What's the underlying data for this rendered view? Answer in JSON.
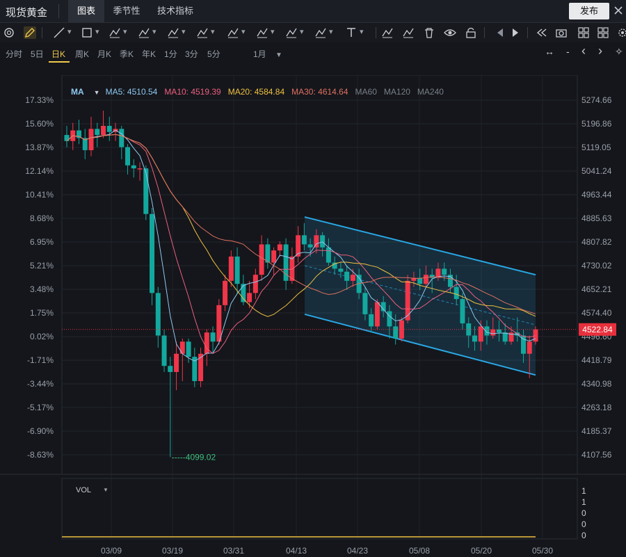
{
  "app": {
    "title": "现货黄金"
  },
  "tabs": [
    {
      "label": "图表",
      "active": true
    },
    {
      "label": "季节性",
      "active": false
    },
    {
      "label": "技术指标",
      "active": false
    }
  ],
  "publish_label": "发布",
  "periods": [
    {
      "label": "分时",
      "active": false
    },
    {
      "label": "5日",
      "active": false
    },
    {
      "label": "日K",
      "active": true
    },
    {
      "label": "周K",
      "active": false
    },
    {
      "label": "月K",
      "active": false
    },
    {
      "label": "季K",
      "active": false
    },
    {
      "label": "年K",
      "active": false
    },
    {
      "label": "1分",
      "active": false
    },
    {
      "label": "3分",
      "active": false
    },
    {
      "label": "5分",
      "active": false
    }
  ],
  "period_dropdown": "1月",
  "period_nav": {
    "expand": "↔",
    "minus": "-",
    "prev": "‹",
    "next": "›",
    "more": "✧"
  },
  "toolbar_icons": [
    "magnet-icon",
    "pen-icon",
    "line-icon",
    "rectangle-icon",
    "parallel-lines-icon",
    "pattern-icon",
    "measure-icon",
    "fib-icon",
    "grid-lines-icon",
    "channel-icon",
    "brush-icon",
    "arrow-icon",
    "text-icon",
    "candle-type-icon",
    "pencil-icon",
    "trash-icon",
    "eye-icon",
    "lock-icon",
    "step-back-icon",
    "step-forward-icon",
    "rewind-icon",
    "camera-icon",
    "layout-icon",
    "grid-icon",
    "settings-icon"
  ],
  "ma_legend": {
    "label": "MA",
    "items": [
      {
        "text": "MA5: 4510.54",
        "color": "#8fc8f0"
      },
      {
        "text": "MA10: 4519.39",
        "color": "#ef5f7f"
      },
      {
        "text": "MA20: 4584.84",
        "color": "#f0c040"
      },
      {
        "text": "MA30: 4614.64",
        "color": "#e07060"
      },
      {
        "text": "MA60",
        "color": "#7a7f88"
      },
      {
        "text": "MA120",
        "color": "#7a7f88"
      },
      {
        "text": "MA240",
        "color": "#7a7f88"
      }
    ]
  },
  "vol": {
    "label": "VOL",
    "ticks": [
      "1",
      "1",
      "0",
      "0",
      "0"
    ]
  },
  "colors": {
    "up": "#f0364a",
    "down": "#13a89e",
    "channel": "#2aa8e6",
    "last_price_bg": "#e8303c"
  },
  "chart_data": {
    "type": "candlestick",
    "y_axis_left": [
      "17.33%",
      "15.60%",
      "13.87%",
      "12.14%",
      "10.41%",
      "8.68%",
      "6.95%",
      "5.21%",
      "3.48%",
      "1.75%",
      "0.02%",
      "-1.71%",
      "-3.44%",
      "-5.17%",
      "-6.90%",
      "-8.63%"
    ],
    "y_axis_right": [
      "5274.66",
      "5196.86",
      "5119.05",
      "5041.24",
      "4963.44",
      "4885.63",
      "4807.82",
      "4730.02",
      "4652.21",
      "4574.40",
      "4496.60",
      "4418.79",
      "4340.98",
      "4263.18",
      "4185.37",
      "4107.56"
    ],
    "ylim": [
      4107.56,
      5274.66
    ],
    "x_ticks": [
      "03/09",
      "03/19",
      "03/31",
      "04/13",
      "04/23",
      "05/08",
      "05/20",
      "05/30"
    ],
    "last_price": "4522.84",
    "low_label": "-----4099.02",
    "candles": [
      [
        5160,
        5140,
        5190,
        5120
      ],
      [
        5140,
        5175,
        5200,
        5110
      ],
      [
        5175,
        5150,
        5210,
        5130
      ],
      [
        5150,
        5110,
        5180,
        5080
      ],
      [
        5110,
        5180,
        5220,
        5090
      ],
      [
        5180,
        5160,
        5200,
        5120
      ],
      [
        5160,
        5190,
        5240,
        5150
      ],
      [
        5190,
        5170,
        5220,
        5140
      ],
      [
        5170,
        5180,
        5200,
        5140
      ],
      [
        5180,
        5120,
        5190,
        5080
      ],
      [
        5120,
        5060,
        5130,
        5030
      ],
      [
        5060,
        5050,
        5080,
        5020
      ],
      [
        5050,
        5050,
        5070,
        5010
      ],
      [
        5050,
        4900,
        5060,
        4880
      ],
      [
        4900,
        4640,
        4920,
        4600
      ],
      [
        4640,
        4500,
        4660,
        4460
      ],
      [
        4500,
        4400,
        4520,
        4380
      ],
      [
        4400,
        4380,
        4430,
        4100
      ],
      [
        4380,
        4440,
        4480,
        4320
      ],
      [
        4440,
        4480,
        4490,
        4350
      ],
      [
        4480,
        4430,
        4490,
        4410
      ],
      [
        4430,
        4350,
        4460,
        4330
      ],
      [
        4350,
        4440,
        4460,
        4330
      ],
      [
        4440,
        4510,
        4520,
        4400
      ],
      [
        4510,
        4480,
        4530,
        4440
      ],
      [
        4480,
        4600,
        4620,
        4470
      ],
      [
        4600,
        4680,
        4700,
        4580
      ],
      [
        4680,
        4760,
        4780,
        4660
      ],
      [
        4760,
        4670,
        4790,
        4640
      ],
      [
        4670,
        4610,
        4700,
        4600
      ],
      [
        4610,
        4640,
        4680,
        4590
      ],
      [
        4640,
        4700,
        4720,
        4620
      ],
      [
        4700,
        4800,
        4830,
        4680
      ],
      [
        4800,
        4740,
        4820,
        4720
      ],
      [
        4740,
        4780,
        4790,
        4700
      ],
      [
        4780,
        4800,
        4810,
        4760
      ],
      [
        4800,
        4680,
        4820,
        4650
      ],
      [
        4680,
        4760,
        4790,
        4670
      ],
      [
        4760,
        4830,
        4860,
        4740
      ],
      [
        4830,
        4800,
        4870,
        4780
      ],
      [
        4800,
        4790,
        4820,
        4760
      ],
      [
        4790,
        4830,
        4850,
        4770
      ],
      [
        4830,
        4790,
        4840,
        4760
      ],
      [
        4790,
        4740,
        4820,
        4730
      ],
      [
        4740,
        4720,
        4760,
        4700
      ],
      [
        4720,
        4710,
        4740,
        4690
      ],
      [
        4710,
        4680,
        4730,
        4650
      ],
      [
        4680,
        4700,
        4720,
        4660
      ],
      [
        4700,
        4640,
        4720,
        4620
      ],
      [
        4640,
        4570,
        4660,
        4550
      ],
      [
        4570,
        4530,
        4590,
        4510
      ],
      [
        4530,
        4610,
        4620,
        4520
      ],
      [
        4610,
        4580,
        4630,
        4560
      ],
      [
        4580,
        4530,
        4600,
        4490
      ],
      [
        4530,
        4490,
        4570,
        4470
      ],
      [
        4490,
        4550,
        4560,
        4480
      ],
      [
        4550,
        4680,
        4700,
        4540
      ],
      [
        4680,
        4690,
        4710,
        4660
      ],
      [
        4690,
        4670,
        4720,
        4650
      ],
      [
        4670,
        4700,
        4730,
        4660
      ],
      [
        4700,
        4690,
        4720,
        4640
      ],
      [
        4690,
        4720,
        4740,
        4680
      ],
      [
        4720,
        4700,
        4740,
        4680
      ],
      [
        4700,
        4660,
        4720,
        4640
      ],
      [
        4660,
        4620,
        4700,
        4600
      ],
      [
        4620,
        4540,
        4640,
        4520
      ],
      [
        4540,
        4500,
        4560,
        4460
      ],
      [
        4500,
        4480,
        4530,
        4450
      ],
      [
        4480,
        4530,
        4550,
        4450
      ],
      [
        4530,
        4500,
        4550,
        4470
      ],
      [
        4500,
        4520,
        4560,
        4490
      ],
      [
        4520,
        4510,
        4550,
        4480
      ],
      [
        4510,
        4480,
        4540,
        4470
      ],
      [
        4480,
        4510,
        4530,
        4470
      ],
      [
        4510,
        4500,
        4560,
        4480
      ],
      [
        4500,
        4440,
        4520,
        4410
      ],
      [
        4440,
        4480,
        4500,
        4360
      ],
      [
        4480,
        4520,
        4530,
        4470
      ]
    ],
    "channel": {
      "top": [
        [
          4890,
          "04/13"
        ],
        [
          4700,
          "05/30"
        ]
      ],
      "bottom": [
        [
          4570,
          "04/13"
        ],
        [
          4370,
          "05/30"
        ]
      ]
    }
  }
}
